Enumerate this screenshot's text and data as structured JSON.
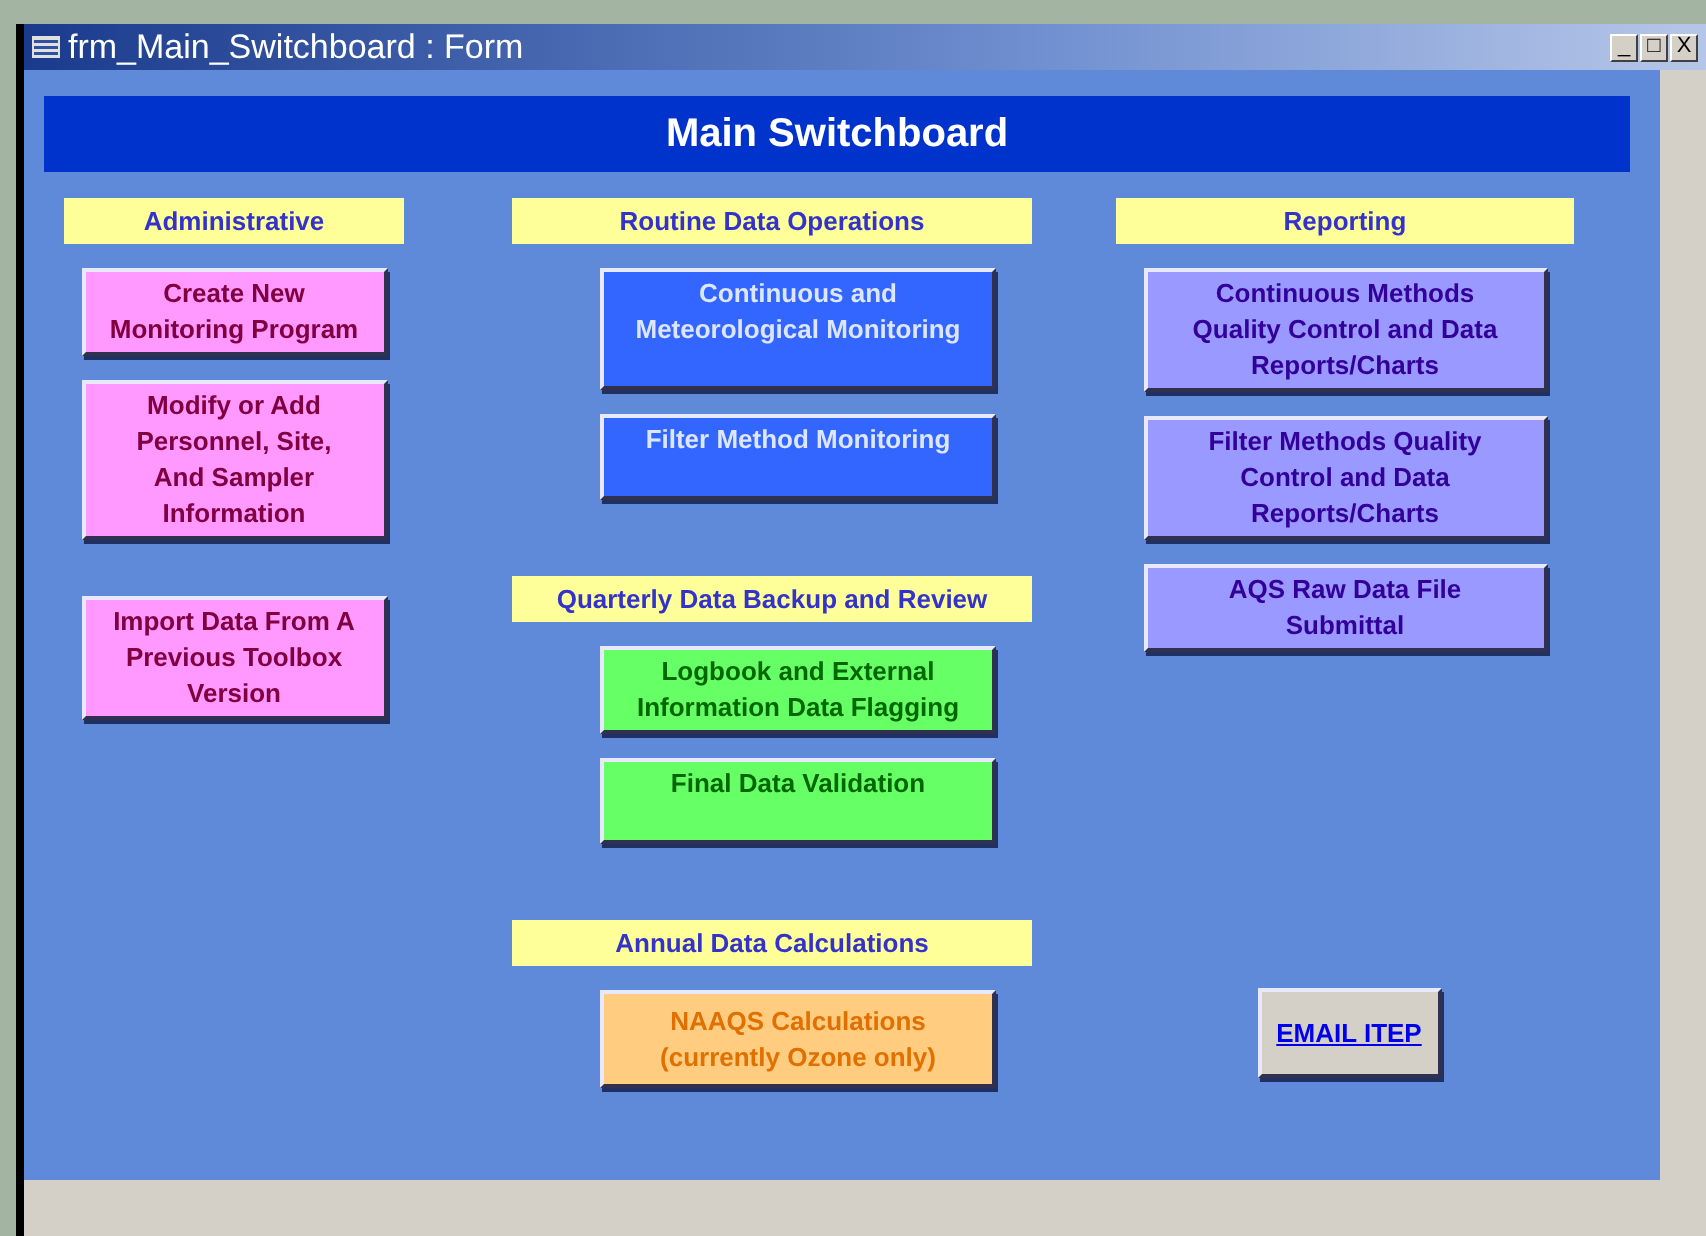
{
  "window": {
    "title": "frm_Main_Switchboard : Form",
    "controls": [
      "_",
      "□",
      "X"
    ]
  },
  "banner": "Main Switchboard",
  "columns": [
    {
      "sections": [
        {
          "heading": "Administrative",
          "buttons": [
            {
              "kind": "admin",
              "lines": [
                "Create New",
                "Monitoring Program"
              ]
            },
            {
              "kind": "admin",
              "lines": [
                "Modify or Add",
                "Personnel, Site,",
                "And Sampler",
                "Information"
              ]
            },
            {
              "kind": "admin",
              "lines": [
                "Import Data From A",
                "Previous Toolbox",
                "Version"
              ]
            }
          ]
        }
      ]
    },
    {
      "sections": [
        {
          "heading": "Routine Data Operations",
          "buttons": [
            {
              "kind": "monitoring",
              "lines": [
                "Continuous and",
                "Meteorological Monitoring"
              ]
            },
            {
              "kind": "monitoring",
              "lines": [
                "Filter Method Monitoring"
              ]
            }
          ]
        },
        {
          "heading": "Quarterly Data Backup and Review",
          "buttons": [
            {
              "kind": "validation",
              "lines": [
                "Logbook and External",
                "Information Data Flagging"
              ]
            },
            {
              "kind": "validation",
              "lines": [
                "Final Data Validation"
              ]
            }
          ]
        },
        {
          "heading": "Annual Data Calculations",
          "buttons": [
            {
              "kind": "calculation",
              "lines": [
                "NAAQS Calculations",
                "(currently Ozone only)"
              ]
            }
          ]
        }
      ]
    },
    {
      "sections": [
        {
          "heading": "Reporting",
          "buttons": [
            {
              "kind": "report",
              "lines": [
                "Continuous Methods",
                "Quality Control and Data",
                "Reports/Charts"
              ]
            },
            {
              "kind": "report",
              "lines": [
                "Filter Methods Quality",
                "Control and Data",
                "Reports/Charts"
              ]
            },
            {
              "kind": "report",
              "lines": [
                "AQS Raw Data File",
                "Submittal"
              ]
            }
          ]
        },
        {
          "buttons": [
            {
              "kind": "email",
              "lines": [
                "EMAIL ITEP"
              ]
            }
          ]
        }
      ]
    }
  ]
}
